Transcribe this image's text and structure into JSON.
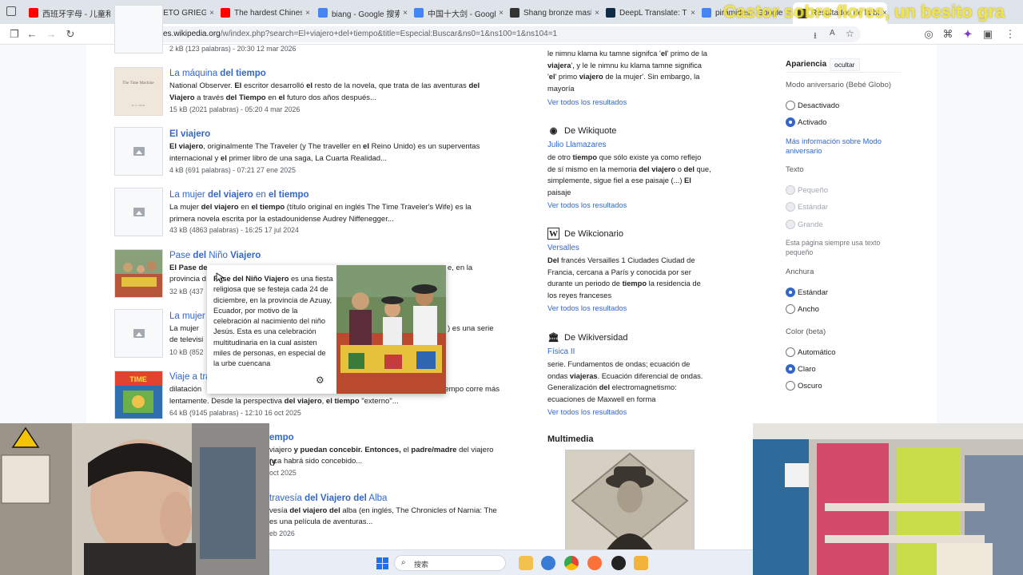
{
  "browser": {
    "tabs": [
      {
        "label": "西班牙字母 - 儿童和婴",
        "favicon": "youtube-icon",
        "color": "#ff0000"
      },
      {
        "label": "ALFABETO GRIEGO (C",
        "favicon": "youtube-icon",
        "color": "#ff0000"
      },
      {
        "label": "The hardest Chinese",
        "favicon": "youtube-icon",
        "color": "#ff0000"
      },
      {
        "label": "biang - Google 搜索",
        "favicon": "google-icon",
        "color": "#4285f4"
      },
      {
        "label": "中国十大剑 - Google 搜",
        "favicon": "google-icon",
        "color": "#4285f4"
      },
      {
        "label": "Shang bronze mask",
        "favicon": "wikipedia-icon",
        "color": "#333333"
      },
      {
        "label": "DeepL Translate: The",
        "favicon": "deepl-icon",
        "color": "#0f2b46"
      },
      {
        "label": "pirámides - Google",
        "favicon": "google-icon",
        "color": "#4285f4"
      },
      {
        "label": "Resultados de la bús",
        "favicon": "wikipedia-icon",
        "color": "#333333",
        "active": true
      }
    ],
    "overlay_text": "Castor sobre flores, un besito gra",
    "url_domain": "es.wikipedia.org",
    "url_rest": "/w/index.php?search=El+viajero+del+tiempo&title=Especial:Buscar&ns0=1&ns100=1&ns104=1"
  },
  "results": [
    {
      "title_html": "",
      "snippet": "",
      "meta": "2 kB (123 palabras) - 20:30 12 mar 2026"
    },
    {
      "title": [
        "La máquina ",
        "del tiempo"
      ],
      "snippet": [
        "National Observer. ",
        "El",
        " escritor desarrolló ",
        "el",
        " resto de la novela, que trata de las aventuras ",
        "del",
        " ",
        "Viajero",
        " a través ",
        "del Tiempo",
        " en ",
        "el",
        " futuro dos años después..."
      ],
      "meta": "15 kB (2021 palabras) - 05:20 4 mar 2026"
    },
    {
      "title": [
        "",
        "El viajero"
      ],
      "snippet": [
        "",
        "El viajero",
        ", originalmente The Traveler (y The traveller en ",
        "el",
        " Reino Unido) es un superventas internacional y ",
        "el",
        " primer libro de una saga, La Cuarta Realidad..."
      ],
      "meta": "4 kB (691 palabras) - 07:21 27 ene 2025"
    },
    {
      "title": [
        "La mujer ",
        "del viajero",
        " en ",
        "el tiempo"
      ],
      "snippet": [
        "La mujer ",
        "del viajero",
        " en ",
        "el tiempo",
        " (título original en inglés The Time Traveler's Wife) es la primera novela escrita por la estadounidense Audrey Niffenegger..."
      ],
      "meta": "43 kB (4863 palabras) - 16:25 17 jul 2024"
    },
    {
      "title": [
        "Pase ",
        "del",
        " Niño ",
        "Viajero"
      ],
      "snippet_left": "El Pase de",
      "snippet_right": "e, en la",
      "snippet_line2": "provincia d",
      "meta": "32 kB (437"
    },
    {
      "title": [
        "La mujer"
      ],
      "snippet_left": "La mujer",
      "snippet_right": ") es una serie",
      "snippet_line2": "de televisi",
      "meta": "10 kB (852"
    },
    {
      "title": [
        "Viaje a tra"
      ],
      "snippet_left": "dilatación",
      "snippet_right": "el tiempo corre más",
      "snippet_line2": [
        "lentamente. Desde la perspectiva ",
        "del viajero",
        ", ",
        "el tiempo",
        " \"externo\"..."
      ],
      "meta": "64 kB (9145 palabras) - 12:10 16 oct 2025"
    },
    {
      "title": [
        "",
        "empo"
      ],
      "snippet": [
        "viajero",
        " y puedan concebir. Entonces, ",
        "el",
        " padre/madre ",
        "del viajero",
        " (y"
      ],
      "snippet_line2": "nca habrá sido concebido...",
      "meta": "oct 2025"
    },
    {
      "title": [
        "travesía ",
        "del Viajero del",
        " Alba"
      ],
      "snippet": [
        "vesía ",
        "del viajero del",
        " alba (en inglés, The Chronicles of Narnia: The"
      ],
      "snippet_line2": "es una película de aventuras...",
      "meta": "eb 2026"
    }
  ],
  "popup": {
    "text": [
      "",
      "Pase del Niño Viajero",
      " es una fiesta religiosa que se festeja cada 24 de diciembre, en la provincia de Azuay, Ecuador, por motivo de la celebración al nacimiento del niño Jesús. Esta es una celebración multitudinaria en la cual asisten miles de personas, en especial de la urbe cuencana"
    ],
    "settings_icon": "gear-icon"
  },
  "sister": {
    "top_text": [
      "le nimnu klama ku tamne signifca '",
      "el",
      "' primo de la ",
      "viajera",
      "', y le le nimnu ku klama tamne significa '",
      "el",
      "' primo ",
      "viajero",
      " de la mujer'. Sin embargo, la mayoría"
    ],
    "top_more": "Ver todos los resultados",
    "sections": [
      {
        "name": "De Wikiquote",
        "icon": "wikiquote-icon",
        "link": "Julio Llamazares",
        "text": [
          "de otro ",
          "tiempo",
          " que sólo existe ya como reflejo de sí mismo en la memoria ",
          "del viajero",
          " o ",
          "del",
          " que, simplemente, sigue fiel a ese paisaje (...) ",
          "El",
          " paisaje"
        ],
        "more": "Ver todos los resultados"
      },
      {
        "name": "De Wikcionario",
        "icon": "wiktionary-icon",
        "link": "Versalles",
        "text": [
          "",
          "Del",
          " francés Versailles 1 Ciudades Ciudad de Francia, cercana a París y conocida por ser durante un periodo de ",
          "tiempo",
          " la residencia de los reyes franceses"
        ],
        "more": "Ver todos los resultados"
      },
      {
        "name": "De Wikiversidad",
        "icon": "wikiversity-icon",
        "link": "Física II",
        "text": [
          "serie. Fundamentos de ondas; ecuación de ondas ",
          "viajeras",
          ". Ecuación diferencial de ondas. Generalización ",
          "del",
          " electromagnetismo: ecuaciones de Maxwell en forma"
        ],
        "more": "Ver todos los resultados"
      }
    ],
    "multimedia_label": "Multimedia"
  },
  "appearance": {
    "title": "Apariencia",
    "hide": "ocultar",
    "anniv_label": "Modo aniversario (Bebé Globo)",
    "anniv_off": "Desactivado",
    "anniv_on": "Activado",
    "more_info": "Más información sobre Modo aniversario",
    "text_label": "Texto",
    "text_small": "Pequeño",
    "text_std": "Estándar",
    "text_large": "Grande",
    "text_note": "Esta página siempre usa texto pequeño",
    "width_label": "Anchura",
    "width_std": "Estándar",
    "width_wide": "Ancho",
    "color_label": "Color (beta)",
    "color_auto": "Automático",
    "color_light": "Claro",
    "color_dark": "Oscuro"
  },
  "taskbar": {
    "search_label": "搜索"
  }
}
